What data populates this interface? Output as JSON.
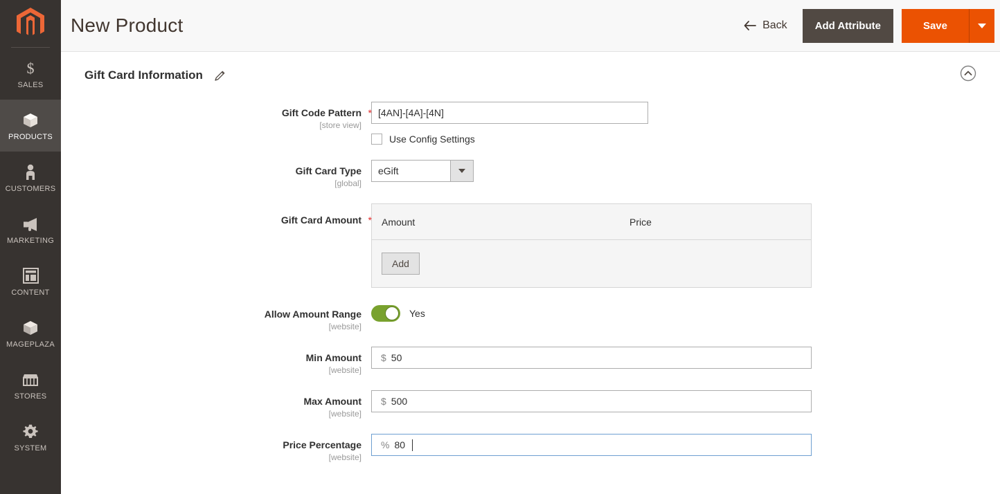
{
  "sidebar": {
    "logo_name": "magento-logo",
    "items": [
      {
        "label": "SALES",
        "icon": "dollar-icon",
        "active": false
      },
      {
        "label": "PRODUCTS",
        "icon": "box-icon",
        "active": true
      },
      {
        "label": "CUSTOMERS",
        "icon": "person-icon",
        "active": false
      },
      {
        "label": "MARKETING",
        "icon": "megaphone-icon",
        "active": false
      },
      {
        "label": "CONTENT",
        "icon": "layout-icon",
        "active": false
      },
      {
        "label": "MAGEPLAZA",
        "icon": "box-icon",
        "active": false
      },
      {
        "label": "STORES",
        "icon": "store-icon",
        "active": false
      },
      {
        "label": "SYSTEM",
        "icon": "gear-icon",
        "active": false
      }
    ]
  },
  "header": {
    "title": "New Product",
    "back_label": "Back",
    "add_attribute_label": "Add Attribute",
    "save_label": "Save"
  },
  "section": {
    "title": "Gift Card Information"
  },
  "form": {
    "gift_code_pattern": {
      "label": "Gift Code Pattern",
      "scope": "[store view]",
      "required": "*",
      "value": "[4AN]-[4A]-[4N]",
      "placeholder": ""
    },
    "use_config": {
      "label": "Use Config Settings",
      "checked": false
    },
    "gift_card_type": {
      "label": "Gift Card Type",
      "scope": "[global]",
      "value": "eGift",
      "options": [
        "eGift"
      ]
    },
    "gift_card_amount": {
      "label": "Gift Card Amount",
      "scope": "",
      "required": "*",
      "columns": [
        "Amount",
        "Price"
      ],
      "rows": [],
      "add_label": "Add"
    },
    "allow_amount_range": {
      "label": "Allow Amount Range",
      "scope": "[website]",
      "value": "Yes",
      "on": true
    },
    "min_amount": {
      "label": "Min Amount",
      "scope": "[website]",
      "symbol": "$",
      "value": "50"
    },
    "max_amount": {
      "label": "Max Amount",
      "scope": "[website]",
      "symbol": "$",
      "value": "500"
    },
    "price_percentage": {
      "label": "Price Percentage",
      "scope": "[website]",
      "symbol": "%",
      "value": "80",
      "focused": true
    }
  },
  "colors": {
    "brand_orange": "#eb5202",
    "sidebar_bg": "#373330",
    "sidebar_active": "#4f4b48",
    "toggle_green": "#79a22e",
    "focus_blue": "#6d9fd1",
    "required_red": "#e22626"
  }
}
